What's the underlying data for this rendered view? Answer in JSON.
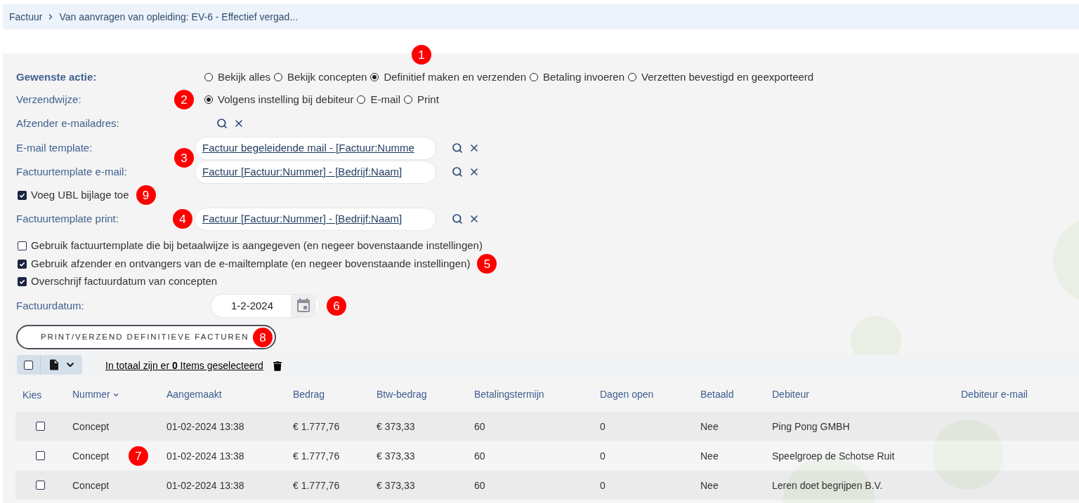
{
  "breadcrumb": {
    "items": [
      {
        "label": "Factuur"
      },
      {
        "label": "Van aanvragen van opleiding: EV-6 - Effectief vergad..."
      }
    ]
  },
  "form": {
    "fields": [
      {
        "kind": "radio",
        "label": "Gewenste actie:",
        "bold": true,
        "callout": "1",
        "options": [
          {
            "label": "Bekijk alles",
            "selected": false
          },
          {
            "label": "Bekijk concepten",
            "selected": false
          },
          {
            "label": "Definitief maken en verzenden",
            "selected": true
          },
          {
            "label": "Betaling invoeren",
            "selected": false
          },
          {
            "label": "Verzetten bevestigd en geexporteerd",
            "selected": false
          }
        ]
      },
      {
        "kind": "radio",
        "label": "Verzendwijze:",
        "callout": "2",
        "options": [
          {
            "label": "Volgens instelling bij debiteur",
            "selected": true
          },
          {
            "label": "E-mail",
            "selected": false
          },
          {
            "label": "Print",
            "selected": false
          }
        ]
      },
      {
        "kind": "lookup",
        "label": "Afzender e-mailadres:"
      },
      {
        "kind": "lookup",
        "label": "E-mail template:",
        "value": "Factuur begeleidende mail - [Factuur:Numme",
        "callout": "3"
      },
      {
        "kind": "lookup",
        "label": "Factuurtemplate e-mail:",
        "value": "Factuur [Factuur:Nummer] - [Bedrijf:Naam]"
      },
      {
        "kind": "checkbox",
        "label": "Voeg UBL bijlage toe",
        "checked": true,
        "callout": "9"
      },
      {
        "kind": "lookup",
        "label": "Factuurtemplate print:",
        "value": "Factuur [Factuur:Nummer] - [Bedrijf:Naam]",
        "callout": "4"
      },
      {
        "kind": "checkbox",
        "label": "Gebruik factuurtemplate die bij betaalwijze is aangegeven (en negeer bovenstaande instellingen)",
        "checked": false
      },
      {
        "kind": "checkbox",
        "label": "Gebruik afzender en ontvangers van de e-mailtemplate (en negeer bovenstaande instellingen)",
        "checked": true,
        "callout": "5"
      },
      {
        "kind": "checkbox",
        "label": "Overschrijf factuurdatum van concepten",
        "checked": true
      },
      {
        "kind": "date",
        "label": "Factuurdatum:",
        "value": "1-2-2024",
        "callout": "6"
      }
    ]
  },
  "submit_button": {
    "label": "PRINT/VERZEND DEFINITIEVE FACTUREN",
    "callout": "8"
  },
  "toolbar": {
    "select_all_checked": false,
    "selection_text": "In totaal zijn er **0** Items geselecteerd"
  },
  "table": {
    "select_column": {
      "label": "Kies"
    },
    "columns": [
      {
        "label": "Nummer",
        "sorted": true
      },
      {
        "label": "Aangemaakt",
        "sorted": false
      },
      {
        "label": "Bedrag",
        "sorted": false
      },
      {
        "label": "Btw-bedrag",
        "sorted": false
      },
      {
        "label": "Betalingstermijn",
        "sorted": false
      },
      {
        "label": "Dagen open",
        "sorted": false
      },
      {
        "label": "Betaald",
        "sorted": false
      },
      {
        "label": "Debiteur",
        "sorted": false
      },
      {
        "label": "Debiteur e-mail",
        "sorted": false
      }
    ],
    "rows": [
      {
        "checked": false,
        "cells": [
          "Concept",
          "01-02-2024 13:38",
          "€ 1.777,76",
          "€ 373,33",
          "60",
          "0",
          "Nee",
          "Ping Pong GMBH"
        ]
      },
      {
        "checked": false,
        "callout": "7",
        "cells": [
          "Concept",
          "01-02-2024 13:38",
          "€ 1.777,76",
          "€ 373,33",
          "60",
          "0",
          "Nee",
          "Speelgroep de Schotse Ruit"
        ]
      },
      {
        "checked": false,
        "cells": [
          "Concept",
          "01-02-2024 13:38",
          "€ 1.777,76",
          "€ 373,33",
          "60",
          "0",
          "Nee",
          "Leren doet begrijpen B.V."
        ]
      }
    ]
  }
}
